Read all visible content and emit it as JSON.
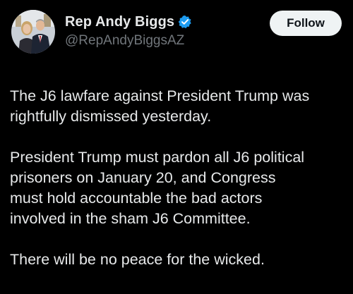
{
  "author": {
    "display_name": "Rep Andy Biggs",
    "handle": "@RepAndyBiggsAZ",
    "verified_icon": "verified-badge-icon"
  },
  "actions": {
    "follow_label": "Follow"
  },
  "post": {
    "paragraphs": [
      "The J6 lawfare against President Trump was\nrightfully dismissed yesterday.",
      "President Trump must pardon all J6 political\nprisoners on January 20, and Congress\nmust hold accountable the bad actors\ninvolved in the sham J6 Committee.",
      "There will be no peace for the wicked."
    ]
  },
  "colors": {
    "background": "#000000",
    "text_primary": "#e7e9ea",
    "text_secondary": "#71767b",
    "verified_badge": "#1d9bf0",
    "follow_button_bg": "#eff3f4"
  }
}
